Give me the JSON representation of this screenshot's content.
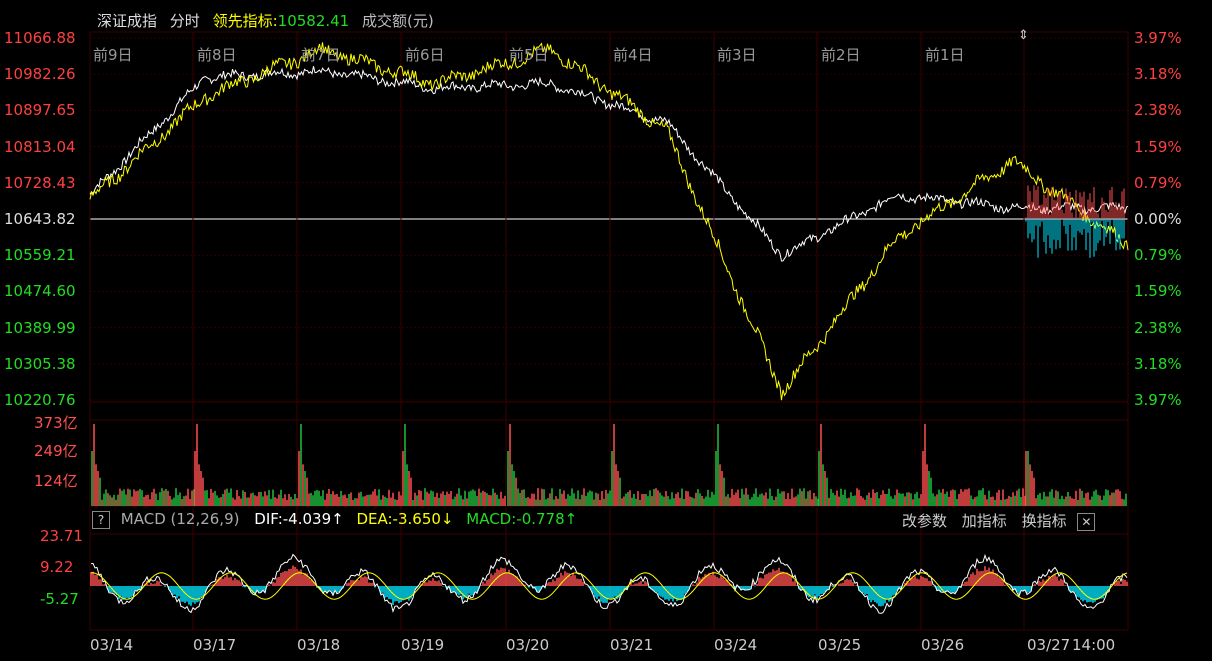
{
  "header": {
    "index_name": "深证成指",
    "mode": "分时",
    "leading_label": "领先指标:",
    "leading_value": "10582.41",
    "volume_label": "成交额(元)"
  },
  "colors": {
    "bg": "#000000",
    "grid": "#2a0000",
    "axis_red": "#ff4040",
    "axis_green": "#22dd22",
    "index_line": "#ffffff",
    "leading_line": "#ffff00",
    "bar_up": "#ff5050",
    "bar_down": "#00e5ff",
    "vol_green": "#20c040"
  },
  "price_axis": {
    "left_labels": [
      "11066.88",
      "10982.26",
      "10897.65",
      "10813.04",
      "10728.43",
      "10643.82",
      "10559.21",
      "10474.60",
      "10389.99",
      "10305.38",
      "10220.76"
    ],
    "right_labels": [
      "3.97%",
      "3.18%",
      "2.38%",
      "1.59%",
      "0.79%",
      "0.00%",
      "0.79%",
      "1.59%",
      "2.38%",
      "3.18%",
      "3.97%"
    ]
  },
  "day_labels": [
    "前9日",
    "前8日",
    "前7日",
    "前6日",
    "前5日",
    "前4日",
    "前3日",
    "前2日",
    "前1日"
  ],
  "volume_axis": [
    "373亿",
    "249亿",
    "124亿"
  ],
  "macd": {
    "help": "?",
    "name": "MACD (12,26,9)",
    "dif": "DIF:-4.039↑",
    "dea": "DEA:-3.650↓",
    "macd": "MACD:-0.778↑",
    "axis": [
      "23.71",
      "9.22",
      "-5.27"
    ],
    "btn_params": "改参数",
    "btn_add": "加指标",
    "btn_switch": "换指标",
    "btn_close": "✕"
  },
  "dates": [
    "03/14",
    "03/17",
    "03/18",
    "03/19",
    "03/20",
    "03/21",
    "03/24",
    "03/25",
    "03/26",
    "03/27",
    "14:00"
  ],
  "chart_data": {
    "type": "line",
    "title": "深证成指",
    "ylim": [
      10220.76,
      11066.88
    ],
    "base": 10643.82,
    "x": [
      "03/14",
      "03/17",
      "03/18",
      "03/19",
      "03/20",
      "03/21",
      "03/24",
      "03/25",
      "03/26",
      "03/27"
    ],
    "series": [
      {
        "name": "深证成指",
        "values": [
          10700,
          10975,
          10990,
          10950,
          10960,
          10870,
          10560,
          10700,
          10670,
          10670
        ]
      },
      {
        "name": "领先指标",
        "values": [
          10690,
          10930,
          11040,
          10960,
          11040,
          10850,
          10240,
          10600,
          10780,
          10582.41
        ]
      }
    ]
  }
}
